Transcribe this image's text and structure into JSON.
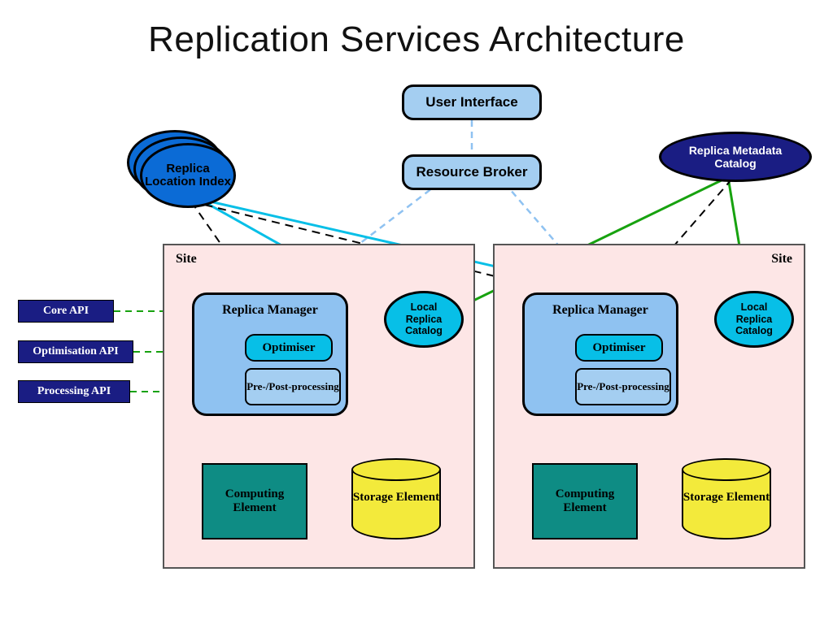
{
  "title": "Replication Services Architecture",
  "top": {
    "ui": "User Interface",
    "broker": "Resource Broker",
    "rli": "Replica Location Index",
    "rmc": "Replica Metadata Catalog"
  },
  "api": {
    "core": "Core API",
    "opt": "Optimisation API",
    "proc": "Processing API"
  },
  "site": {
    "label": "Site",
    "rm": "Replica Manager",
    "optimiser": "Optimiser",
    "prepost": "Pre-/Post-processing",
    "lrc": "Local Replica Catalog",
    "compute": "Computing Element",
    "storage": "Storage Element"
  },
  "colors": {
    "lightblue": "#a4cef1",
    "midblue": "#8fc2f1",
    "deepblue": "#1a1d83",
    "cyan": "#07bfe7",
    "royal": "#0b6bd6",
    "teal": "#0e8c84",
    "yellow": "#f3ea3b",
    "green": "#17a20f",
    "rose": "#fde6e6"
  }
}
